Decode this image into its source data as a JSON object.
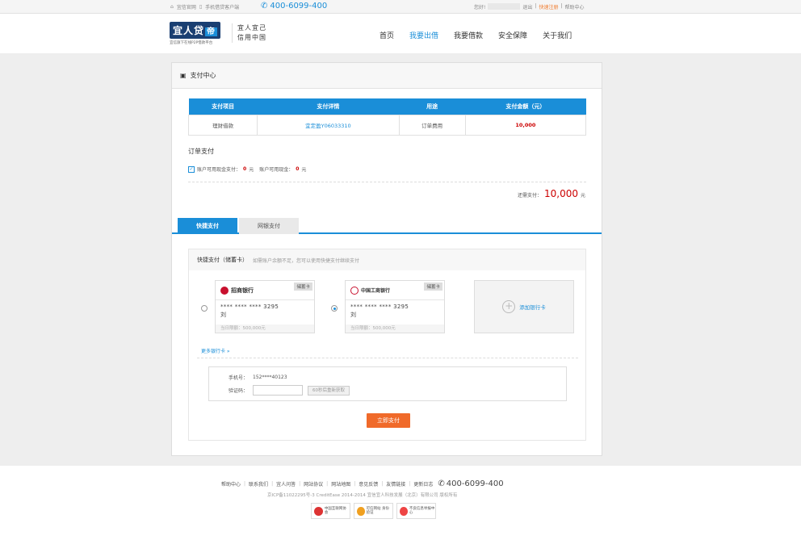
{
  "topbar": {
    "official_site": "宜信官网",
    "mobile_client": "手机借贷客户端",
    "phone": "400-6099-400",
    "greeting": "您好!",
    "logout": "退出",
    "quick_register": "快速注册",
    "help_center": "帮助中心"
  },
  "header": {
    "logo_main": "宜人贷",
    "logo_tag": "帝",
    "logo_sub": "宜信旗下在线P2P借款平台",
    "slogan_line1": "宜人宜己",
    "slogan_line2": "信用中国",
    "nav": [
      "首页",
      "我要出借",
      "我要借款",
      "安全保障",
      "关于我们"
    ]
  },
  "panel": {
    "title": "支付中心",
    "table": {
      "headers": [
        "支付项目",
        "支付详情",
        "用途",
        "支付金额（元）"
      ],
      "row": [
        "理财借款",
        "宜定盈Y06033310",
        "订单费用",
        "10,000"
      ]
    },
    "order_title": "订单支付",
    "balance_label": "账户可用现金支付：",
    "balance_value": "0",
    "balance_unit": "元",
    "avail_label": "账户可用现金：",
    "avail_value": "0",
    "avail_unit": "元",
    "due_label": "还需支付：",
    "due_amount": "10,000",
    "due_unit": "元",
    "tabs": [
      "快捷支付",
      "网银支付"
    ],
    "quick": {
      "title": "快捷支付（储蓄卡）",
      "hint": "如需账户余额不足，您可以使用快捷支付继续支付",
      "cards": [
        {
          "bank": "招商银行",
          "tag": "储蓄卡",
          "number": "**** **** **** 3295",
          "name": "刘",
          "limit": "当日限额：500,000元"
        },
        {
          "bank": "中国工商银行",
          "tag": "储蓄卡",
          "number": "**** **** **** 3295",
          "name": "刘",
          "limit": "当日限额：500,000元"
        }
      ],
      "add_card": "添加银行卡",
      "more_cards": "更多银行卡 »",
      "phone_label": "手机号：",
      "phone_value": "152****40123",
      "code_label": "验证码：",
      "code_button": "60秒后重新获取",
      "pay_button": "立即支付"
    }
  },
  "footer": {
    "links": [
      "帮助中心",
      "联系我们",
      "宜人问答",
      "网站协议",
      "网站地图",
      "意见反馈",
      "友情链接",
      "更新日志"
    ],
    "phone": "400-6099-400",
    "copyright": "京ICP备11022295号-3 CreditEase 2014-2014  宜信宜人科技发展（北京）有限公司 版权所有",
    "badges": [
      "中国互联网协会",
      "可信网站 身份验证",
      "不良信息举报中心"
    ]
  },
  "colors": {
    "accent": "#1a8ed8",
    "danger": "#cc0000",
    "button": "#f06a2a"
  }
}
